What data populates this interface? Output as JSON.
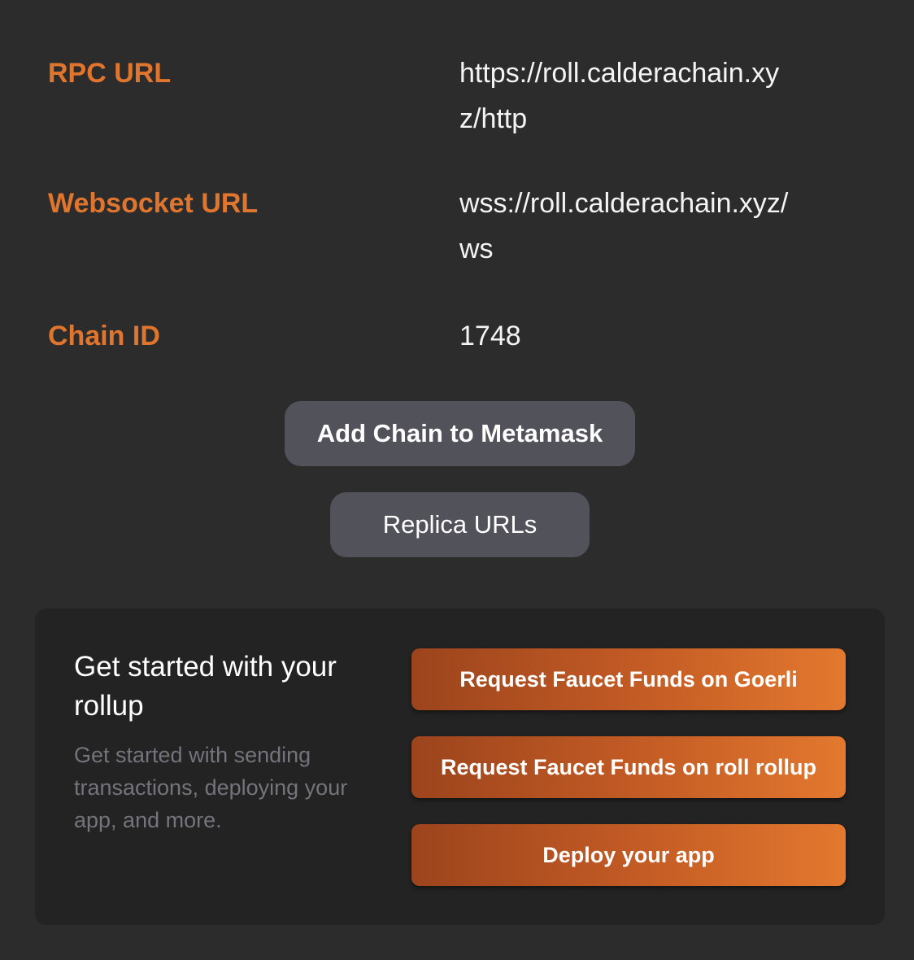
{
  "network_info": {
    "rpc_url": {
      "label": "RPC URL",
      "value": "https://roll.calderachain.xyz/http"
    },
    "websocket_url": {
      "label": "Websocket URL",
      "value": "wss://roll.calderachain.xyz/ws"
    },
    "chain_id": {
      "label": "Chain ID",
      "value": "1748"
    }
  },
  "actions": {
    "add_chain_label": "Add Chain to Metamask",
    "replica_urls_label": "Replica URLs"
  },
  "get_started": {
    "title": "Get started with your rollup",
    "description": "Get started with sending transactions, deploying your app, and more.",
    "buttons": {
      "faucet_goerli": "Request Faucet Funds on Goerli",
      "faucet_rollup": "Request Faucet Funds on roll rollup",
      "deploy": "Deploy your app"
    }
  },
  "colors": {
    "accent": "#e0752e",
    "background": "#2c2c2d",
    "card_background": "#232323",
    "secondary_button": "#51525a",
    "muted_text": "#74747c"
  }
}
